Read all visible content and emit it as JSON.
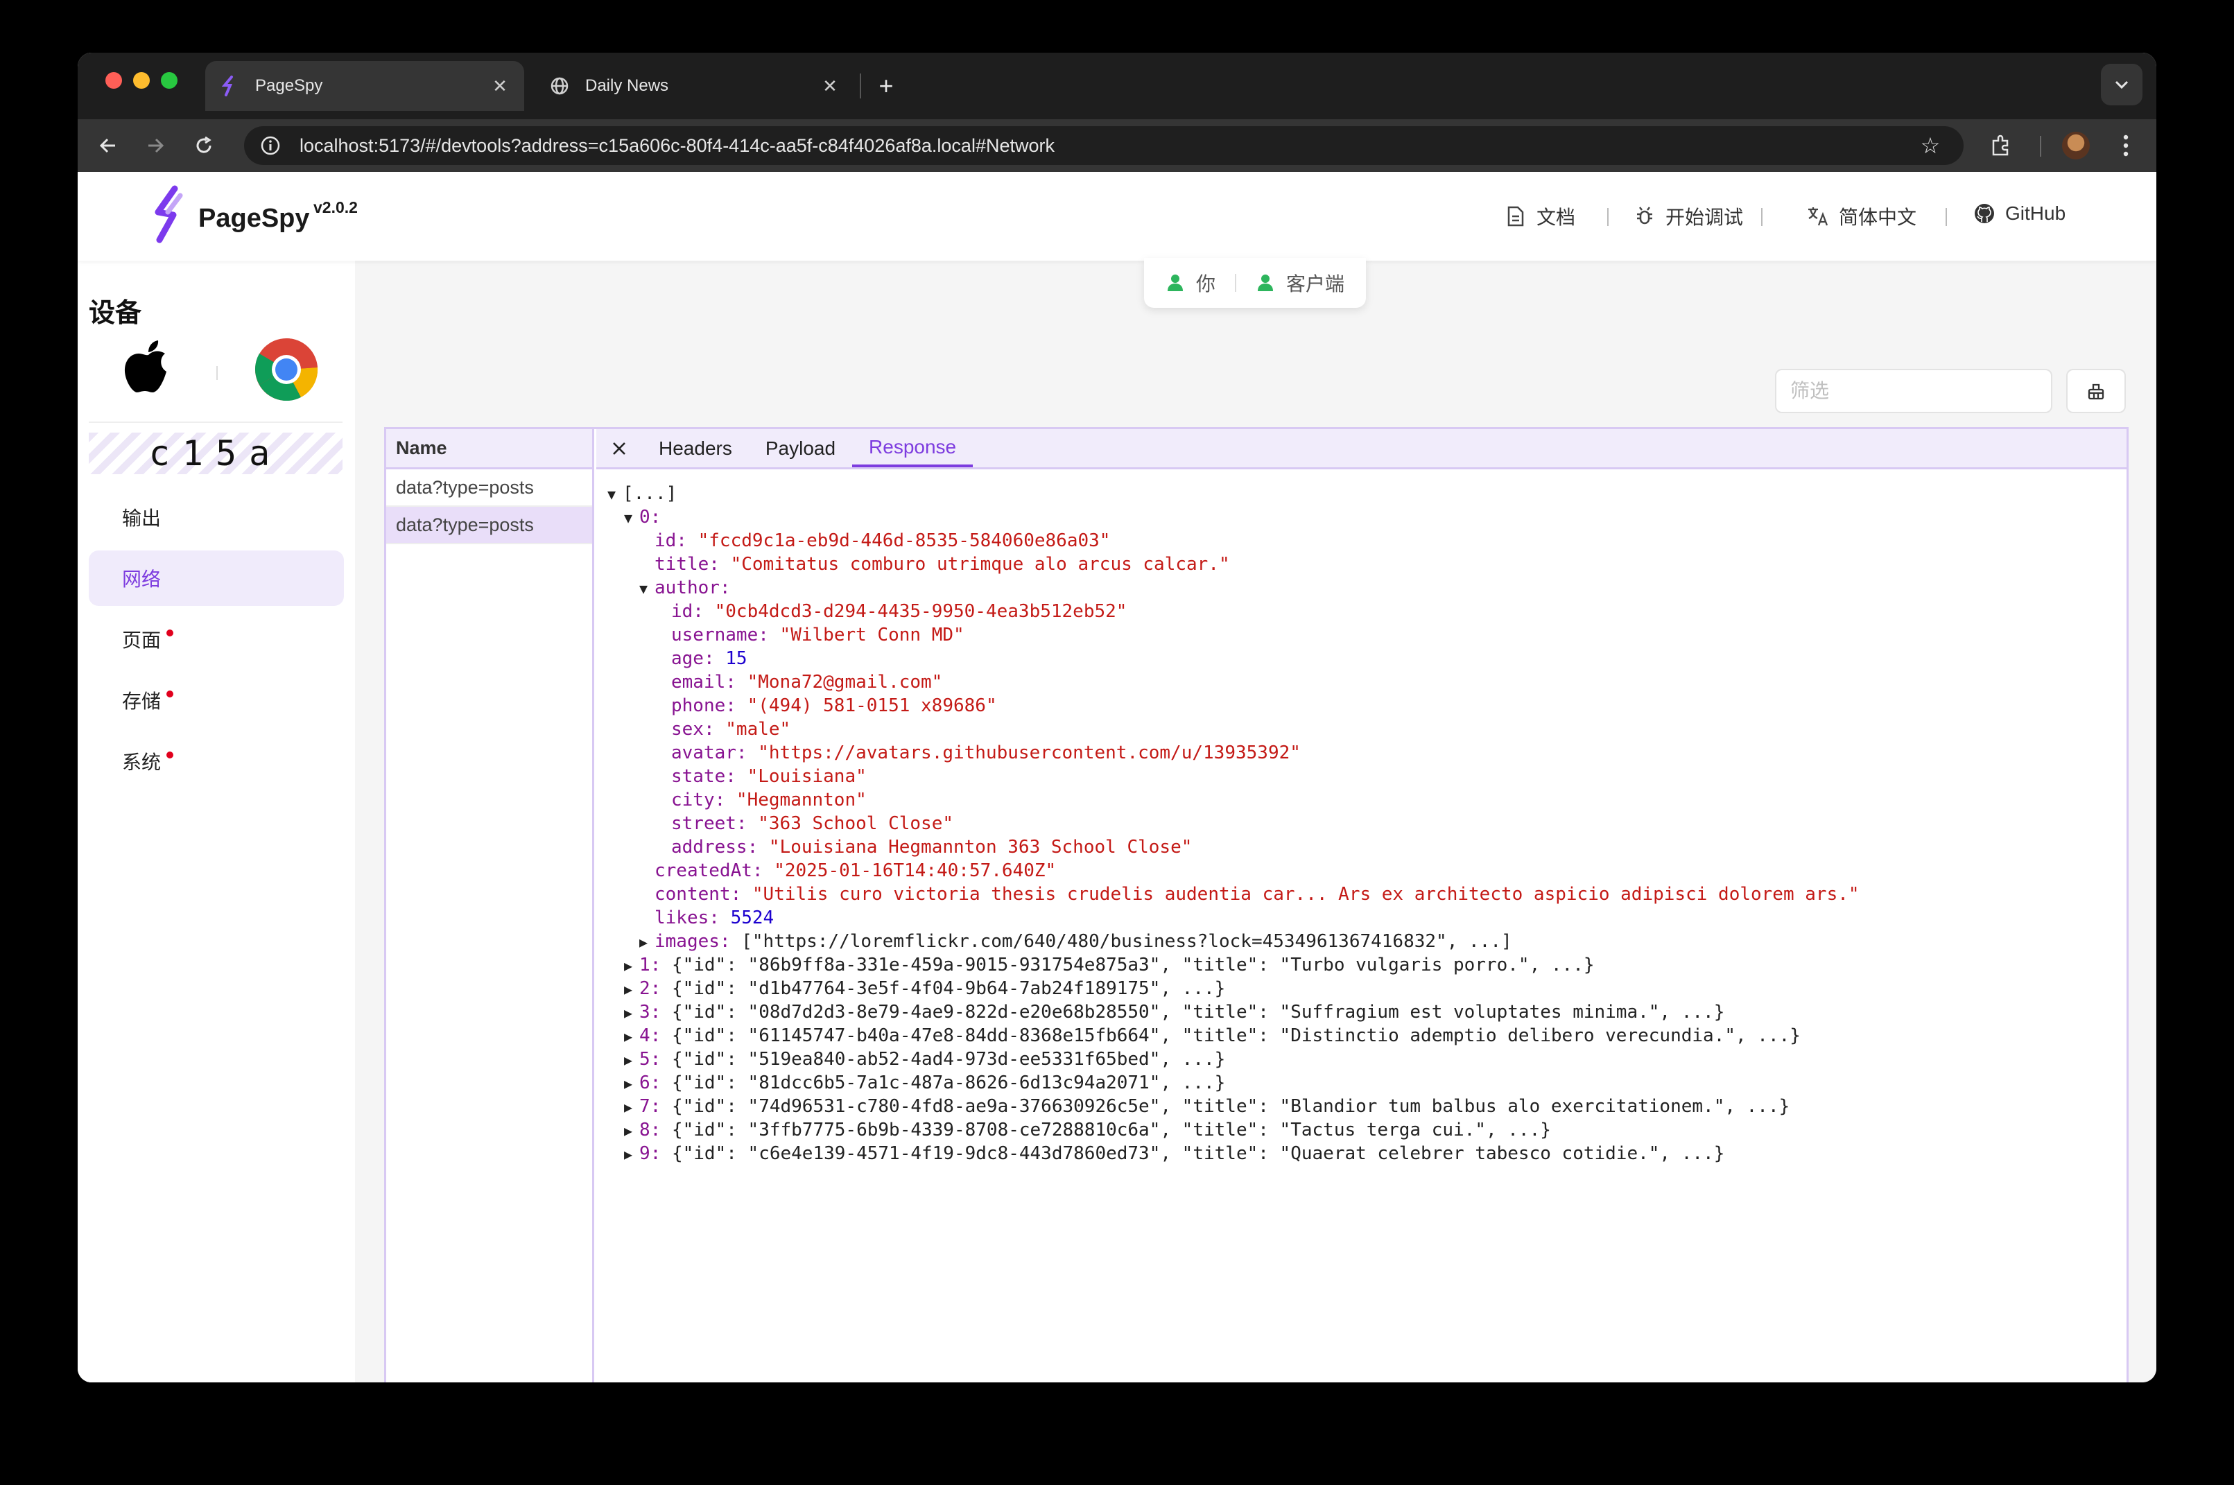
{
  "browser": {
    "tabs": [
      {
        "title": "PageSpy",
        "active": true
      },
      {
        "title": "Daily News",
        "active": false
      }
    ],
    "new_tab_label": "+",
    "url": "localhost:5173/#/devtools?address=c15a606c-80f4-414c-aa5f-c84f4026af8a.local#Network"
  },
  "header": {
    "brand": "PageSpy",
    "version": "v2.0.2",
    "nav": [
      {
        "label": "文档",
        "icon": "document-icon"
      },
      {
        "label": "开始调试",
        "icon": "bug-icon"
      },
      {
        "label": "简体中文",
        "icon": "translate-icon"
      },
      {
        "label": "GitHub",
        "icon": "github-icon"
      }
    ]
  },
  "connection": {
    "you": "你",
    "client": "客户端",
    "status_color": "#2db55d"
  },
  "sidebar": {
    "title": "设备",
    "device_code": "c15a",
    "menu": [
      {
        "label": "输出",
        "active": false,
        "dot": false
      },
      {
        "label": "网络",
        "active": true,
        "dot": false
      },
      {
        "label": "页面",
        "active": false,
        "dot": true
      },
      {
        "label": "存储",
        "active": false,
        "dot": true
      },
      {
        "label": "系统",
        "active": false,
        "dot": true
      }
    ]
  },
  "toolbar": {
    "filter_placeholder": "筛选"
  },
  "network": {
    "name_header": "Name",
    "requests": [
      {
        "name": "data?type=posts",
        "selected": false
      },
      {
        "name": "data?type=posts",
        "selected": true
      }
    ],
    "detail_tabs": [
      {
        "label": "Headers",
        "active": false
      },
      {
        "label": "Payload",
        "active": false
      },
      {
        "label": "Response",
        "active": true
      }
    ]
  },
  "response": {
    "root": "[...]",
    "item0_key": "0",
    "id": "\"fccd9c1a-eb9d-446d-8535-584060e86a03\"",
    "title": "\"Comitatus comburo utrimque alo arcus calcar.\"",
    "author": {
      "id": "\"0cb4dcd3-d294-4435-9950-4ea3b512eb52\"",
      "username": "\"Wilbert Conn MD\"",
      "age": "15",
      "email": "\"Mona72@gmail.com\"",
      "phone": "\"(494) 581-0151 x89686\"",
      "sex": "\"male\"",
      "avatar": "\"https://avatars.githubusercontent.com/u/13935392\"",
      "state": "\"Louisiana\"",
      "city": "\"Hegmannton\"",
      "street": "\"363 School Close\"",
      "address": "\"Louisiana Hegmannton 363 School Close\""
    },
    "createdAt": "\"2025-01-16T14:40:57.640Z\"",
    "content": "\"Utilis curo victoria thesis crudelis audentia car... Ars ex architecto aspicio adipisci dolorem ars.\"",
    "likes": "5524",
    "images": "[\"https://loremflickr.com/640/480/business?lock=4534961367416832\", ...]",
    "collapsed_items": [
      {
        "key": "1",
        "preview": "{\"id\": \"86b9ff8a-331e-459a-9015-931754e875a3\", \"title\": \"Turbo vulgaris porro.\", ...}"
      },
      {
        "key": "2",
        "preview": "{\"id\": \"d1b47764-3e5f-4f04-9b64-7ab24f189175\", ...}"
      },
      {
        "key": "3",
        "preview": "{\"id\": \"08d7d2d3-8e79-4ae9-822d-e20e68b28550\", \"title\": \"Suffragium est voluptates minima.\", ...}"
      },
      {
        "key": "4",
        "preview": "{\"id\": \"61145747-b40a-47e8-84dd-8368e15fb664\", \"title\": \"Distinctio ademptio delibero verecundia.\", ...}"
      },
      {
        "key": "5",
        "preview": "{\"id\": \"519ea840-ab52-4ad4-973d-ee5331f65bed\", ...}"
      },
      {
        "key": "6",
        "preview": "{\"id\": \"81dcc6b5-7a1c-487a-8626-6d13c94a2071\", ...}"
      },
      {
        "key": "7",
        "preview": "{\"id\": \"74d96531-c780-4fd8-ae9a-376630926c5e\", \"title\": \"Blandior tum balbus alo exercitationem.\", ...}"
      },
      {
        "key": "8",
        "preview": "{\"id\": \"3ffb7775-6b9b-4339-8708-ce7288810c6a\", \"title\": \"Tactus terga cui.\", ...}"
      },
      {
        "key": "9",
        "preview": "{\"id\": \"c6e4e139-4571-4f19-9dc8-443d7860ed73\", \"title\": \"Quaerat celebrer tabesco cotidie.\", ...}"
      }
    ]
  },
  "colors": {
    "accent": "#7d3cdf",
    "json_key": "#881391",
    "json_string": "#c41a16",
    "json_number": "#1c00cf"
  }
}
